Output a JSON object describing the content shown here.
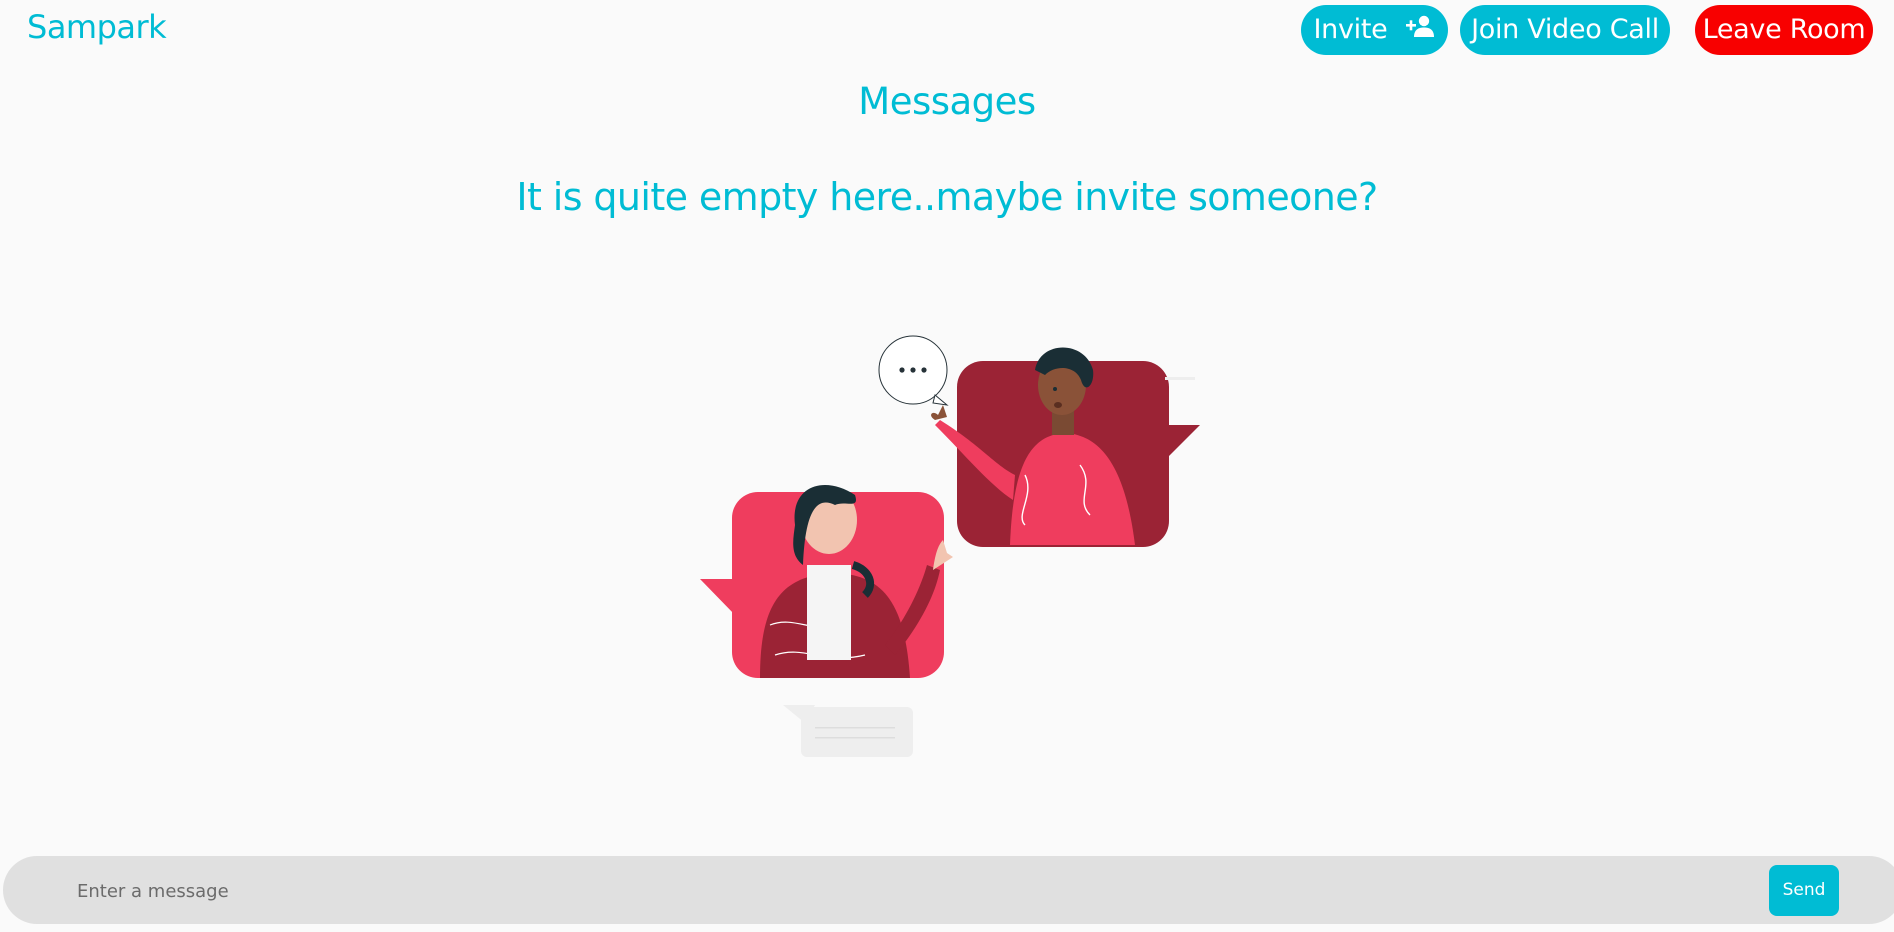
{
  "app": {
    "name": "Sampark"
  },
  "header": {
    "invite_label": "Invite",
    "invite_icon": "person-add-icon",
    "join_video_label": "Join Video Call",
    "leave_room_label": "Leave Room"
  },
  "main": {
    "heading": "Messages",
    "empty_state": "It is quite empty here..maybe invite someone?",
    "illustration": "two-people-chatting-illustration"
  },
  "composer": {
    "placeholder": "Enter a message",
    "value": "",
    "send_label": "Send"
  },
  "colors": {
    "accent": "#00bcd4",
    "danger": "#f80000",
    "background": "#fafafa",
    "composer_bg": "#e0e0e0"
  }
}
